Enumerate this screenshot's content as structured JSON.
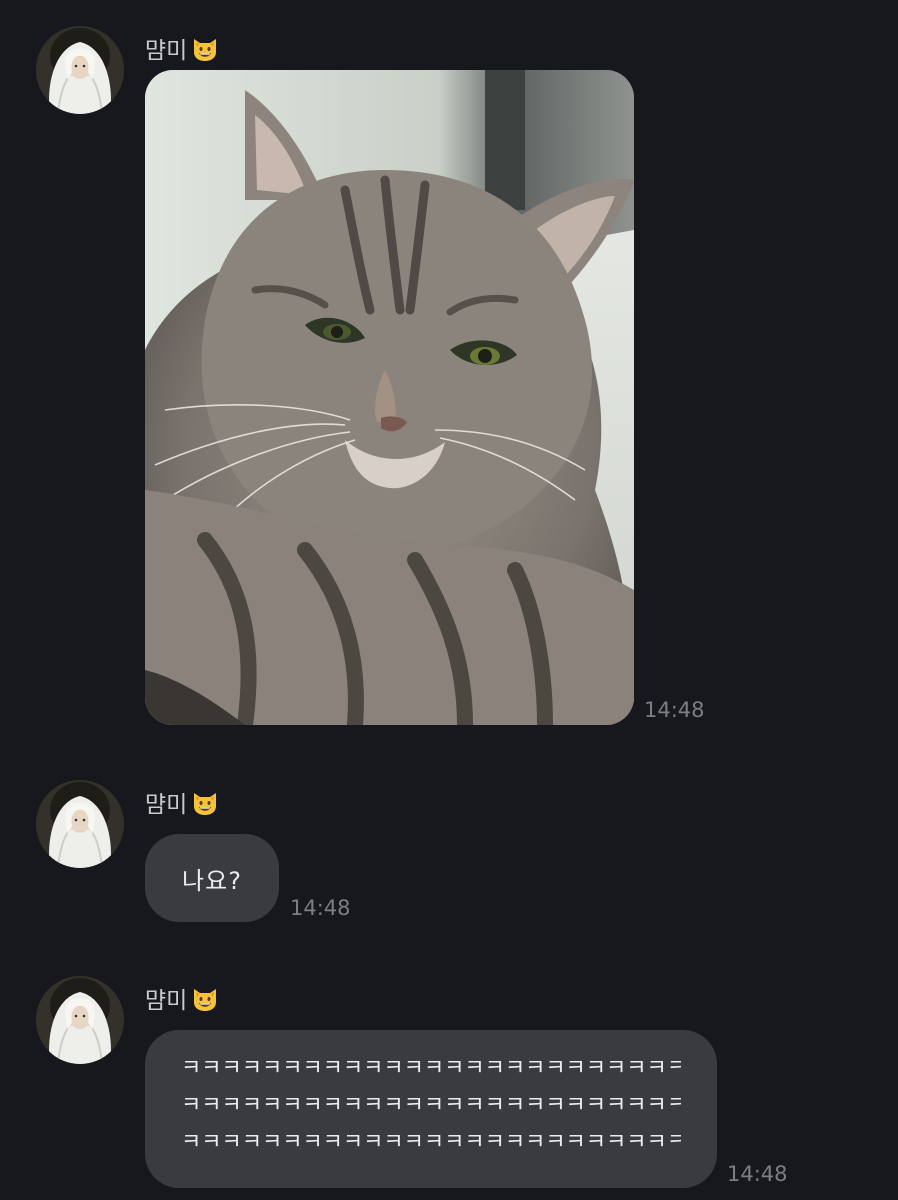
{
  "colors": {
    "background": "#17181d",
    "bubble": "#3a3b40",
    "sender_text": "#c9c9ce",
    "message_text": "#ececf0",
    "timestamp_text": "#7d7e84"
  },
  "messages": [
    {
      "sender": {
        "name": "먐미",
        "emoji_icon": "grinning-cat-icon",
        "avatar_icon": "person-wrapped-in-blanket-avatar"
      },
      "type": "image",
      "image_icon": "gray-tabby-cat-photo",
      "time": "14:48"
    },
    {
      "sender": {
        "name": "먐미",
        "emoji_icon": "grinning-cat-icon",
        "avatar_icon": "person-wrapped-in-blanket-avatar"
      },
      "type": "text",
      "text": "나요?",
      "time": "14:48"
    },
    {
      "sender": {
        "name": "먐미",
        "emoji_icon": "grinning-cat-icon",
        "avatar_icon": "person-wrapped-in-blanket-avatar"
      },
      "type": "text",
      "lines": [
        "ㅋㅋㅋㅋㅋㅋㅋㅋㅋㅋㅋㅋㅋㅋㅋㅋㅋㅋㅋㅋㅋㅋㅋㅋㅋㅋㅋㅋㅋ",
        "ㅋㅋㅋㅋㅋㅋㅋㅋㅋㅋㅋㅋㅋㅋㅋㅋㅋㅋㅋㅋㅋㅋㅋㅋㅋㅋㅋㅋㅋ",
        "ㅋㅋㅋㅋㅋㅋㅋㅋㅋㅋㅋㅋㅋㅋㅋㅋㅋㅋㅋㅋㅋㅋㅋㅋㅋㅋㅋㅋ"
      ],
      "time": "14:48"
    }
  ]
}
